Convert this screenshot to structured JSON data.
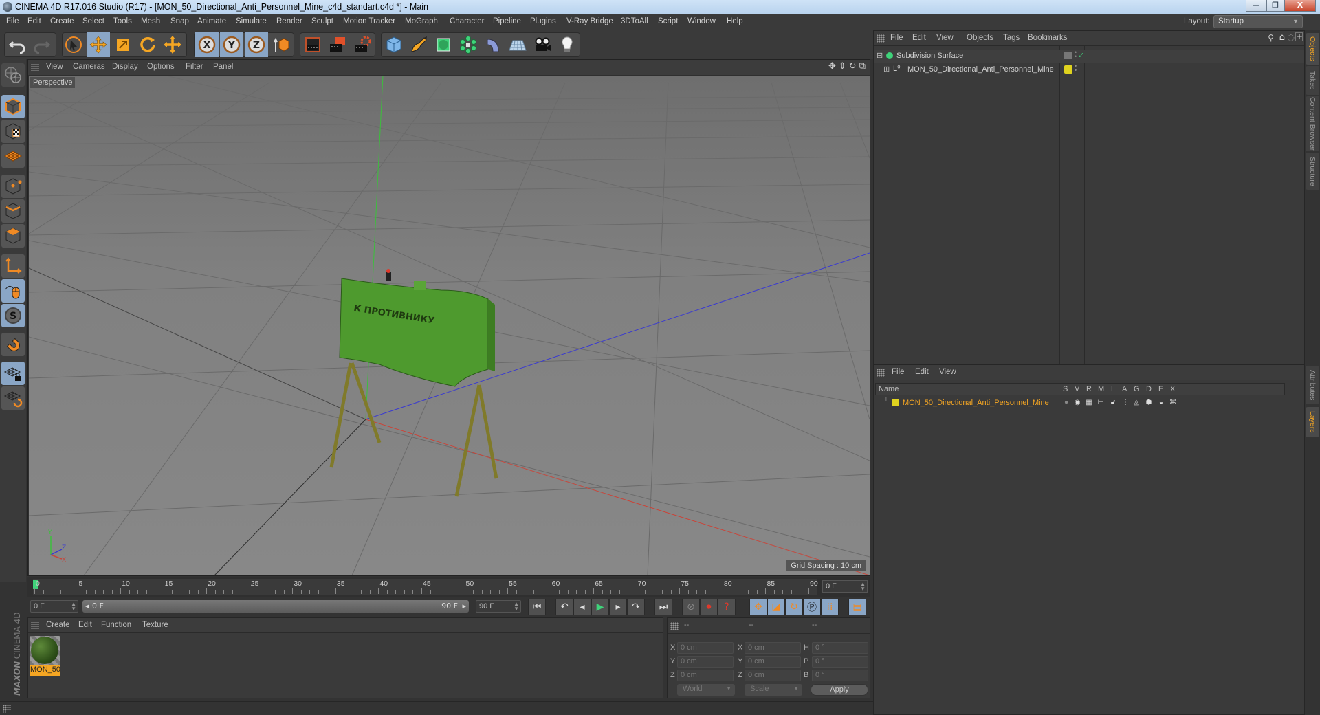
{
  "window": {
    "title": "CINEMA 4D R17.016 Studio (R17) - [MON_50_Directional_Anti_Personnel_Mine_c4d_standart.c4d *] - Main",
    "controls": {
      "minimize": "—",
      "restore": "❐",
      "close": "X"
    }
  },
  "menubar": {
    "items": [
      "File",
      "Edit",
      "Create",
      "Select",
      "Tools",
      "Mesh",
      "Snap",
      "Animate",
      "Simulate",
      "Render",
      "Sculpt",
      "Motion Tracker",
      "MoGraph",
      "Character",
      "Pipeline",
      "Plugins",
      "V-Ray Bridge",
      "3DToAll",
      "Script",
      "Window",
      "Help"
    ],
    "layout_label": "Layout:",
    "layout_value": "Startup"
  },
  "toolbar": {
    "tools": [
      "undo-icon",
      "redo-icon",
      "live-selection-icon",
      "move-icon",
      "scale-icon",
      "rotate-icon",
      "transform-icon",
      "x-axis-lock-icon",
      "y-axis-lock-icon",
      "z-axis-lock-icon",
      "coordinate-system-icon",
      "render-view-icon",
      "render-picture-viewer-icon",
      "render-settings-icon",
      "cube-object-icon",
      "pen-spline-icon",
      "subdivision-icon",
      "cloner-icon",
      "deformer-icon",
      "floor-icon",
      "camera-icon",
      "light-icon"
    ]
  },
  "left_tools": [
    "make-editable-icon",
    "model-mode-icon",
    "texture-mode-icon",
    "workplane-mode-icon",
    "points-mode-icon",
    "edges-mode-icon",
    "polygons-mode-icon",
    "axis-mode-icon",
    "tweak-mode-icon",
    "solo-icon",
    "snap-icon",
    "workplane-lock-icon",
    "workplane-align-icon"
  ],
  "viewport": {
    "menu": [
      "View",
      "Cameras",
      "Display",
      "Options",
      "Filter",
      "Panel"
    ],
    "label": "Perspective",
    "grid_spacing": "Grid Spacing : 10 cm",
    "model_text": "К ПРОТИВНИКУ",
    "axis_labels": {
      "x": "X",
      "y": "Y",
      "z": "Z"
    }
  },
  "timeline": {
    "ticks": [
      "0",
      "5",
      "10",
      "15",
      "20",
      "25",
      "30",
      "35",
      "40",
      "45",
      "50",
      "55",
      "60",
      "65",
      "70",
      "75",
      "80",
      "85",
      "90"
    ],
    "current_frame": "0 F",
    "start_field": "0 F",
    "range_start": "0 F",
    "range_end": "90 F",
    "end_field": "90 F"
  },
  "material_panel": {
    "menu": [
      "Create",
      "Edit",
      "Function",
      "Texture"
    ],
    "materials": [
      {
        "name": "MON_50"
      }
    ]
  },
  "coords_panel": {
    "headers": [
      "--",
      "--",
      "--"
    ],
    "rows": [
      {
        "a": "X",
        "pos": "0 cm",
        "b": "X",
        "size": "0 cm",
        "c": "H",
        "rot": "0 °"
      },
      {
        "a": "Y",
        "pos": "0 cm",
        "b": "Y",
        "size": "0 cm",
        "c": "P",
        "rot": "0 °"
      },
      {
        "a": "Z",
        "pos": "0 cm",
        "b": "Z",
        "size": "0 cm",
        "c": "B",
        "rot": "0 °"
      }
    ],
    "coord_system": "World",
    "mode": "Scale",
    "apply_label": "Apply"
  },
  "objects_panel": {
    "menu": [
      "File",
      "Edit",
      "View",
      "Objects",
      "Tags",
      "Bookmarks"
    ],
    "items": [
      {
        "name": "Subdivision Surface",
        "color": "#3fd37a"
      },
      {
        "name": "MON_50_Directional_Anti_Personnel_Mine",
        "color": "#e0d31f"
      }
    ]
  },
  "layers_panel": {
    "menu": [
      "File",
      "Edit",
      "View"
    ],
    "columns": [
      "Name",
      "S",
      "V",
      "R",
      "M",
      "L",
      "A",
      "G",
      "D",
      "E",
      "X"
    ],
    "layers": [
      {
        "name": "MON_50_Directional_Anti_Personnel_Mine",
        "color": "#e0d31f",
        "text_color": "#f5a623"
      }
    ]
  },
  "right_tabs": {
    "top": [
      "Objects",
      "Takes",
      "Content Browser",
      "Structure"
    ],
    "bottom": [
      "Attributes",
      "Layers"
    ]
  },
  "branding": {
    "maxon": "MAXON",
    "product": "CINEMA 4D"
  },
  "colors": {
    "accent": "#f5a623",
    "active_blue": "#8aa6c6",
    "playhead": "#3fd37a"
  }
}
